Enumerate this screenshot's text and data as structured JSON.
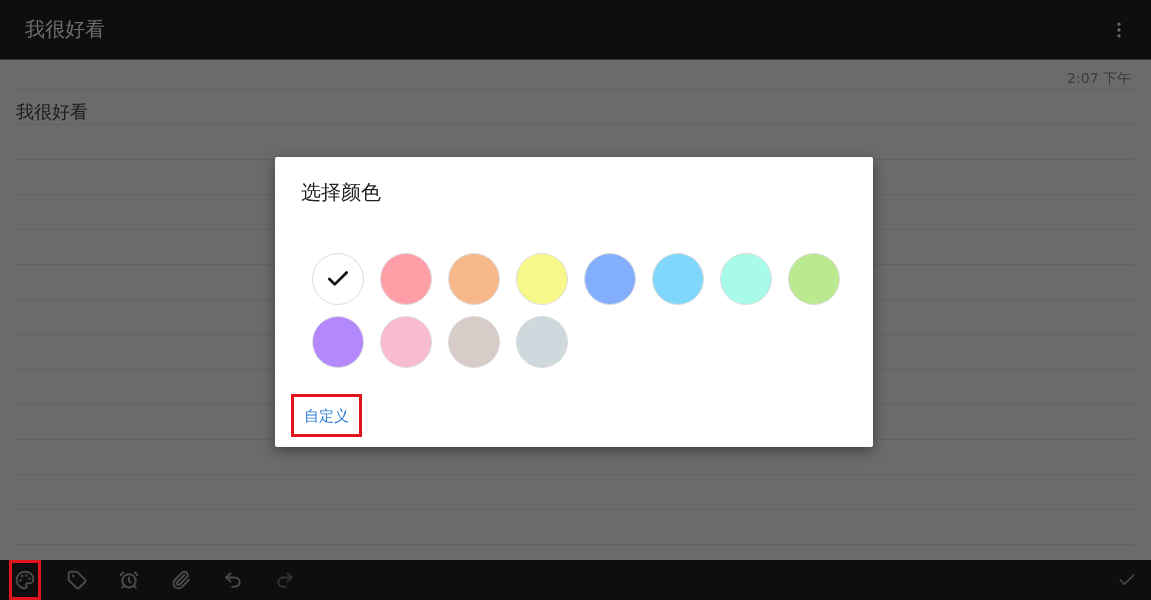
{
  "app_bar": {
    "title": "我很好看"
  },
  "note": {
    "timestamp": "2:07 下午",
    "text": "我很好看"
  },
  "dialog": {
    "title": "选择颜色",
    "swatches": [
      {
        "color": "#ffffff",
        "selected": true
      },
      {
        "color": "#ff9ea6",
        "selected": false
      },
      {
        "color": "#f7b98b",
        "selected": false
      },
      {
        "color": "#f8f88a",
        "selected": false
      },
      {
        "color": "#82aefc",
        "selected": false
      },
      {
        "color": "#80d7fb",
        "selected": false
      },
      {
        "color": "#a8fbe9",
        "selected": false
      },
      {
        "color": "#bbe98f",
        "selected": false
      },
      {
        "color": "#b388fd",
        "selected": false
      },
      {
        "color": "#f8bbd0",
        "selected": false
      },
      {
        "color": "#d7ccc8",
        "selected": false
      },
      {
        "color": "#cfd8dc",
        "selected": false
      }
    ],
    "custom_button": {
      "label": "自定义",
      "highlighted": true
    }
  },
  "toolbar": [
    {
      "kind": "palette",
      "disabled": false,
      "highlighted": true
    },
    {
      "kind": "label",
      "disabled": false,
      "highlighted": false
    },
    {
      "kind": "alarm",
      "disabled": false,
      "highlighted": false
    },
    {
      "kind": "attach",
      "disabled": false,
      "highlighted": false
    },
    {
      "kind": "undo",
      "disabled": false,
      "highlighted": false
    },
    {
      "kind": "redo",
      "disabled": true,
      "highlighted": false
    }
  ]
}
